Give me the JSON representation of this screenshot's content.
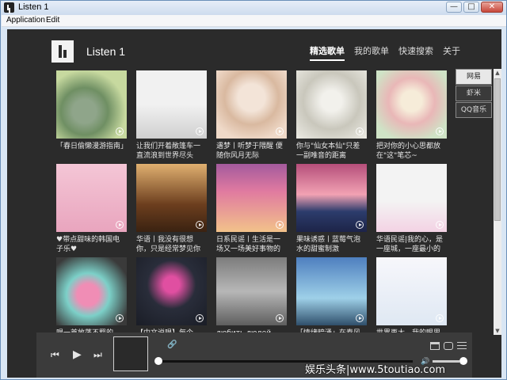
{
  "window": {
    "title": "Listen 1",
    "controls": {
      "minimize": "—",
      "maximize": "□",
      "close": "✕"
    }
  },
  "menubar": [
    "Application",
    "Edit"
  ],
  "header": {
    "app_title": "Listen 1",
    "nav": [
      "精选歌单",
      "我的歌单",
      "快速搜索",
      "关于"
    ],
    "active_nav": "精选歌单"
  },
  "sources": {
    "items": [
      "网易",
      "虾米",
      "QQ音乐"
    ],
    "active": "网易"
  },
  "playlists": [
    {
      "title": "「春日偷懒漫游指南」"
    },
    {
      "title": "让我们开着敞篷车一直流浪到世界尽头"
    },
    {
      "title": "遇梦丨听梦于隈醒 便随你风月无际"
    },
    {
      "title": "你与\"仙女本仙\"只差一副唯音的距离"
    },
    {
      "title": "把对你的小心思都放在\"这\"笔芯~"
    },
    {
      "title": "♥带点甜味的韩国电子乐♥"
    },
    {
      "title": "华语丨我没有很想你，只是经常梦见你"
    },
    {
      "title": "日系民谣丨生活是一场又一场美好事物的邂逅"
    },
    {
      "title": "果味诱惑丨蓝莓气泡水的甜蜜制激"
    },
    {
      "title": "华语民谣|我的心，是一座城，一座最小的城"
    },
    {
      "title": "唱一首放荡不羁的歌，"
    },
    {
      "title": "【中文说唱】每个"
    },
    {
      "title": "любить людей"
    },
    {
      "title": "「情绪暗涌」在春风里"
    },
    {
      "title": "世界再大，我的眼里只"
    }
  ],
  "player": {
    "prev_icon": "⏮",
    "play_icon": "▶",
    "next_icon": "⏭",
    "progress": 0.0,
    "volume": 0.85
  },
  "watermark": "娱乐头条|www.5toutiao.com"
}
